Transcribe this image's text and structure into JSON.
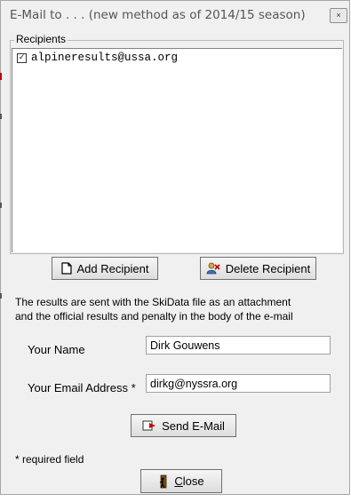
{
  "window": {
    "title": "E-Mail to . . .  (new method as of 2014/15 season)",
    "close_glyph": "×"
  },
  "recipients": {
    "label": "Recipients",
    "items": [
      {
        "email": "alpineresults@ussa.org",
        "checked": true
      }
    ]
  },
  "buttons": {
    "add_recipient": "Add Recipient",
    "delete_recipient": "Delete Recipient",
    "send_email": "Send E-Mail",
    "close_prefix": "",
    "close_underlined": "C",
    "close_rest": "lose"
  },
  "info": {
    "line1": "The results are sent with the SkiData file as an attachment",
    "line2": "and the official results and penalty in the body of the e-mail"
  },
  "form": {
    "name_label": "Your Name",
    "name_value": "Dirk Gouwens",
    "email_label": "Your Email Address *",
    "email_value": "dirkg@nyssra.org"
  },
  "footnote": "* required field",
  "colors": {
    "background": "#f0f0f0",
    "list_background": "#ffffff",
    "accent_red": "#c00000"
  },
  "icons": {
    "add": "document-icon",
    "delete": "delete-person-icon",
    "send": "send-mail-icon",
    "close": "exit-door-icon",
    "close_window": "close-icon"
  }
}
